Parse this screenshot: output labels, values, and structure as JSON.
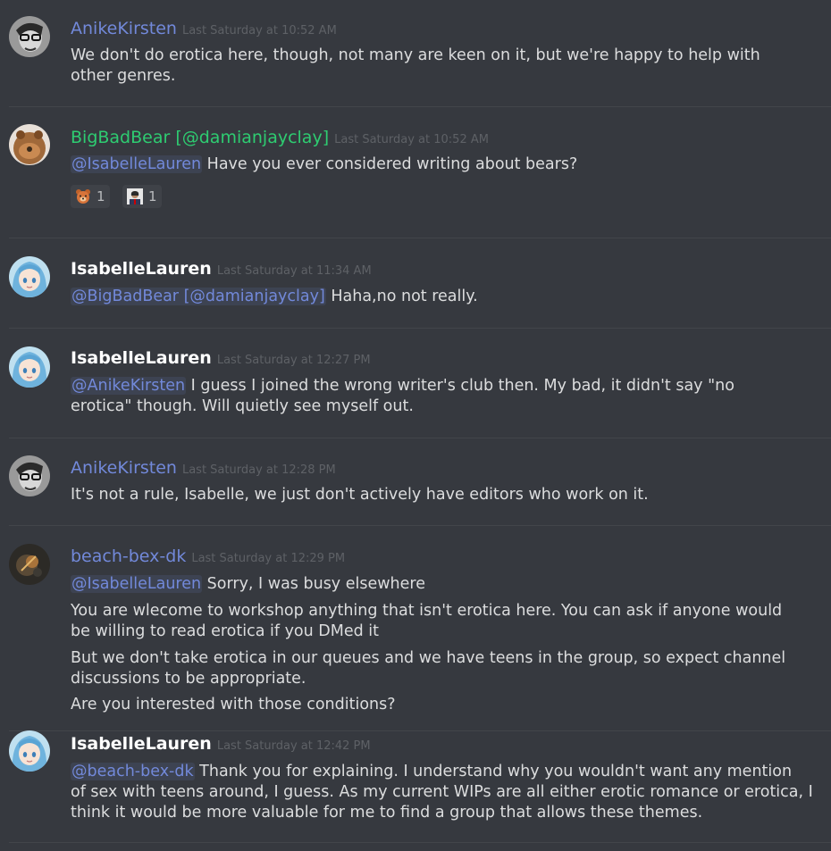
{
  "colors": {
    "background": "#36393f",
    "mention": "#7289da",
    "green_author": "#2ecc71"
  },
  "messages": [
    {
      "author": "AnikeKirsten",
      "timestamp": "Last Saturday at 10:52 AM",
      "lines": [
        {
          "text": "We don't do erotica here, though, not many are keen on it, but we're happy to help with"
        },
        {
          "text": "other genres."
        }
      ]
    },
    {
      "author": "BigBadBear [@damianjayclay]",
      "timestamp": "Last Saturday at 10:52 AM",
      "lines": [
        {
          "mention": "@IsabelleLauren",
          "text": " Have you ever considered writing about bears?"
        }
      ],
      "reactions": [
        {
          "icon": "bear-emoji-icon",
          "count": "1"
        },
        {
          "icon": "person-emoji-icon",
          "count": "1"
        }
      ]
    },
    {
      "author": "IsabelleLauren",
      "timestamp": "Last Saturday at 11:34 AM",
      "lines": [
        {
          "mention": "@BigBadBear [@damianjayclay]",
          "text": " Haha,no not really."
        }
      ]
    },
    {
      "author": "IsabelleLauren",
      "timestamp": "Last Saturday at 12:27 PM",
      "lines": [
        {
          "mention": "@AnikeKirsten",
          "text": " I guess I joined the wrong writer's club then. My bad, it didn't say \"no"
        },
        {
          "text": "erotica\" though. Will quietly see myself out."
        }
      ]
    },
    {
      "author": "AnikeKirsten",
      "timestamp": "Last Saturday at 12:28 PM",
      "lines": [
        {
          "text": "It's not a rule, Isabelle, we just don't actively have editors who work on it."
        }
      ]
    },
    {
      "author": "beach-bex-dk",
      "timestamp": "Last Saturday at 12:29 PM",
      "lines": [
        {
          "mention": "@IsabelleLauren",
          "text": " Sorry, I was busy elsewhere"
        },
        {
          "text": "You are wlecome to workshop anything that isn't erotica here. You can ask if anyone would"
        },
        {
          "text": "be willing to read erotica if you DMed it"
        },
        {
          "text": "But we don't take erotica in our queues and we have teens in the group, so expect channel"
        },
        {
          "text": "discussions to be appropriate."
        },
        {
          "text": "Are you interested with those conditions?"
        }
      ]
    },
    {
      "author": "IsabelleLauren",
      "timestamp": "Last Saturday at 12:42 PM",
      "lines": [
        {
          "mention": "@beach-bex-dk",
          "text": " Thank you for explaining. I understand why you wouldn't want any mention"
        },
        {
          "text": "of sex with teens around, I guess. As my current WIPs are all either erotic romance or erotica, I"
        },
        {
          "text": "think it would be more valuable for me to find a group that allows these themes."
        }
      ]
    }
  ]
}
